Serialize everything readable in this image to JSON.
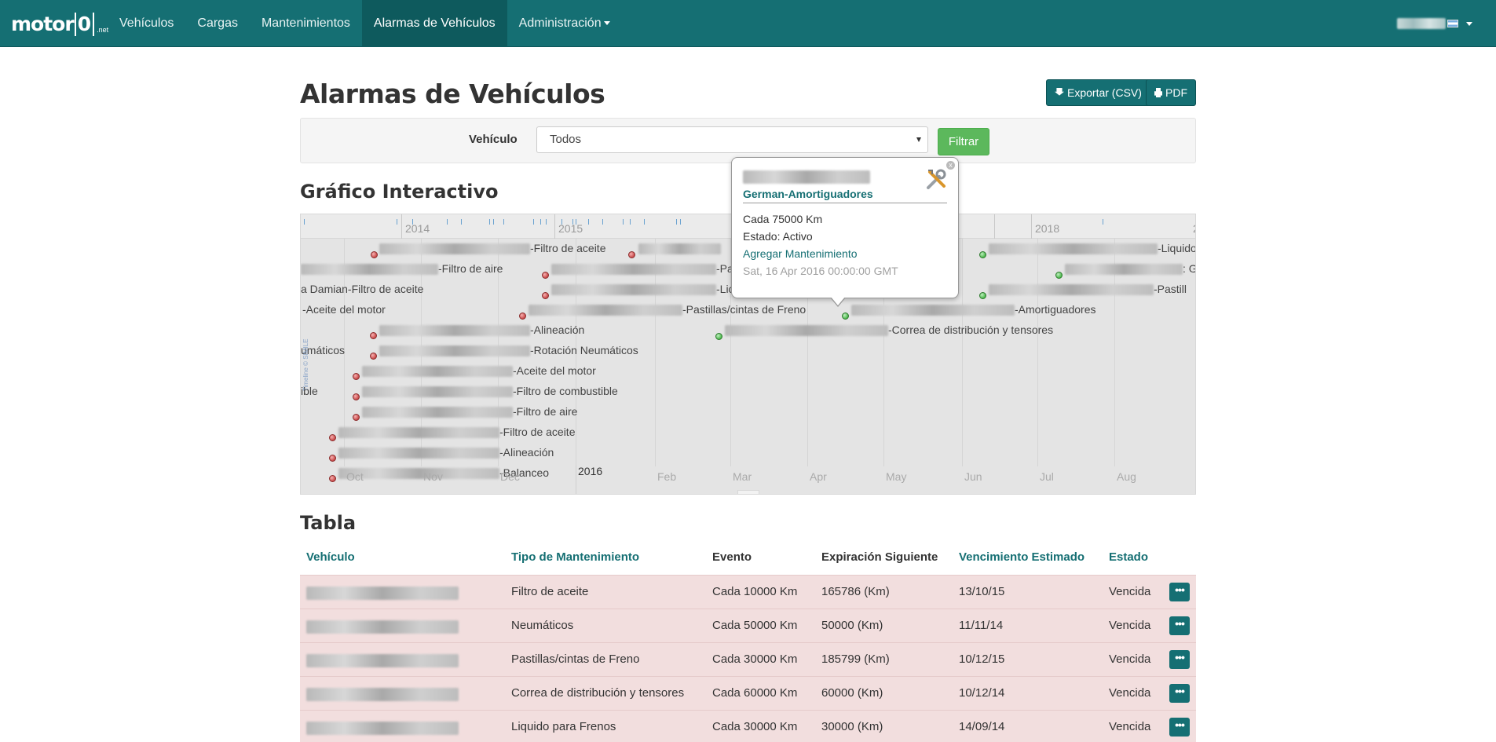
{
  "nav": {
    "brand": {
      "main": "motor",
      "zero": "0",
      "suffix": ".net"
    },
    "items": [
      {
        "label": "Vehículos"
      },
      {
        "label": "Cargas"
      },
      {
        "label": "Mantenimientos"
      },
      {
        "label": "Alarmas de Vehículos",
        "active": true
      },
      {
        "label": "Administración",
        "dropdown": true
      }
    ],
    "user": {
      "name": "",
      "flag": "argentina-flag-icon"
    }
  },
  "page": {
    "title": "Alarmas de Vehículos",
    "export_csv": "Exportar (CSV)",
    "export_pdf": "PDF"
  },
  "filter": {
    "label": "Vehículo",
    "selected": "Todos",
    "button": "Filtrar"
  },
  "timeline": {
    "title": "Gráfico Interactivo",
    "years": [
      "2014",
      "2015",
      "2016",
      "2018",
      "2"
    ],
    "months": [
      "Oct",
      "Nov",
      "Dec",
      "2016",
      "Feb",
      "Mar",
      "Apr",
      "May",
      "Jun",
      "Jul",
      "Aug"
    ],
    "watermark": "Timeline © SIMILE",
    "events": [
      "-Filtro de aceite",
      "-Filtro de aire",
      "a Damian-Filtro de aceite",
      "-Aceite del motor",
      "-Alineación",
      "umáticos",
      "-Rotación Neumáticos",
      "-Aceite del motor",
      "ible",
      "-Filtro de combustible",
      "-Filtro de aire",
      "-Filtro de aceite",
      "-Alineación",
      "-Balanceo",
      "-Pa",
      "-Lic",
      "-Pastillas/cintas de Freno",
      "-Correa de distribución y tensores",
      "-Amortiguadores",
      "-Liquido",
      ": G",
      "-Pastill"
    ],
    "popup": {
      "title": "German-Amortiguadores",
      "interval": "Cada 75000 Km",
      "status": "Estado: Activo",
      "action": "Agregar Mantenimiento",
      "date": "Sat, 16 Apr 2016 00:00:00 GMT",
      "close": "x"
    }
  },
  "table": {
    "title": "Tabla",
    "headers": {
      "vehicle": "Vehículo",
      "type": "Tipo de Mantenimiento",
      "event": "Evento",
      "next": "Expiración Siguiente",
      "due": "Vencimiento Estimado",
      "status": "Estado"
    },
    "rows": [
      {
        "type": "Filtro de aceite",
        "event": "Cada 10000 Km",
        "next": "165786 (Km)",
        "due": "13/10/15",
        "status": "Vencida"
      },
      {
        "type": "Neumáticos",
        "event": "Cada 50000 Km",
        "next": "50000 (Km)",
        "due": "11/11/14",
        "status": "Vencida"
      },
      {
        "type": "Pastillas/cintas de Freno",
        "event": "Cada 30000 Km",
        "next": "185799 (Km)",
        "due": "10/12/15",
        "status": "Vencida"
      },
      {
        "type": "Correa de distribución y tensores",
        "event": "Cada 60000 Km",
        "next": "60000 (Km)",
        "due": "10/12/14",
        "status": "Vencida"
      },
      {
        "type": "Liquido para Frenos",
        "event": "Cada 30000 Km",
        "next": "30000 (Km)",
        "due": "14/09/14",
        "status": "Vencida"
      }
    ],
    "more_label": "•••"
  }
}
